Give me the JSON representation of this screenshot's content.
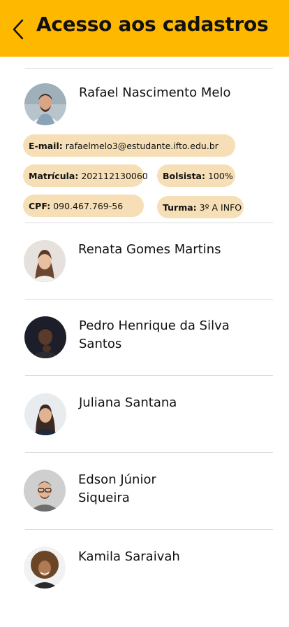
{
  "header": {
    "title": "Acesso aos cadastros",
    "back_icon": "chevron-left-icon",
    "background": "#FFB800"
  },
  "expanded": {
    "name": "Rafael Nascimento Melo",
    "email_label": "E-mail:",
    "email_value": "rafaelmelo3@estudante.ifto.edu.br",
    "matricula_label": "Matrícula:",
    "matricula_value": "202112130060",
    "bolsista_label": "Bolsista:",
    "bolsista_value": "100%",
    "cpf_label": "CPF:",
    "cpf_value": "090.467.769-56",
    "turma_label": "Turma:",
    "turma_value": "3º A INFO",
    "chip_color": "#F6DFB6"
  },
  "students": [
    {
      "name": "Renata Gomes Martins"
    },
    {
      "name": "Pedro Henrique da Silva Santos"
    },
    {
      "name": "Juliana Santana"
    },
    {
      "name": "Edson Júnior Siqueira"
    },
    {
      "name": "Kamila Saraivah"
    }
  ]
}
